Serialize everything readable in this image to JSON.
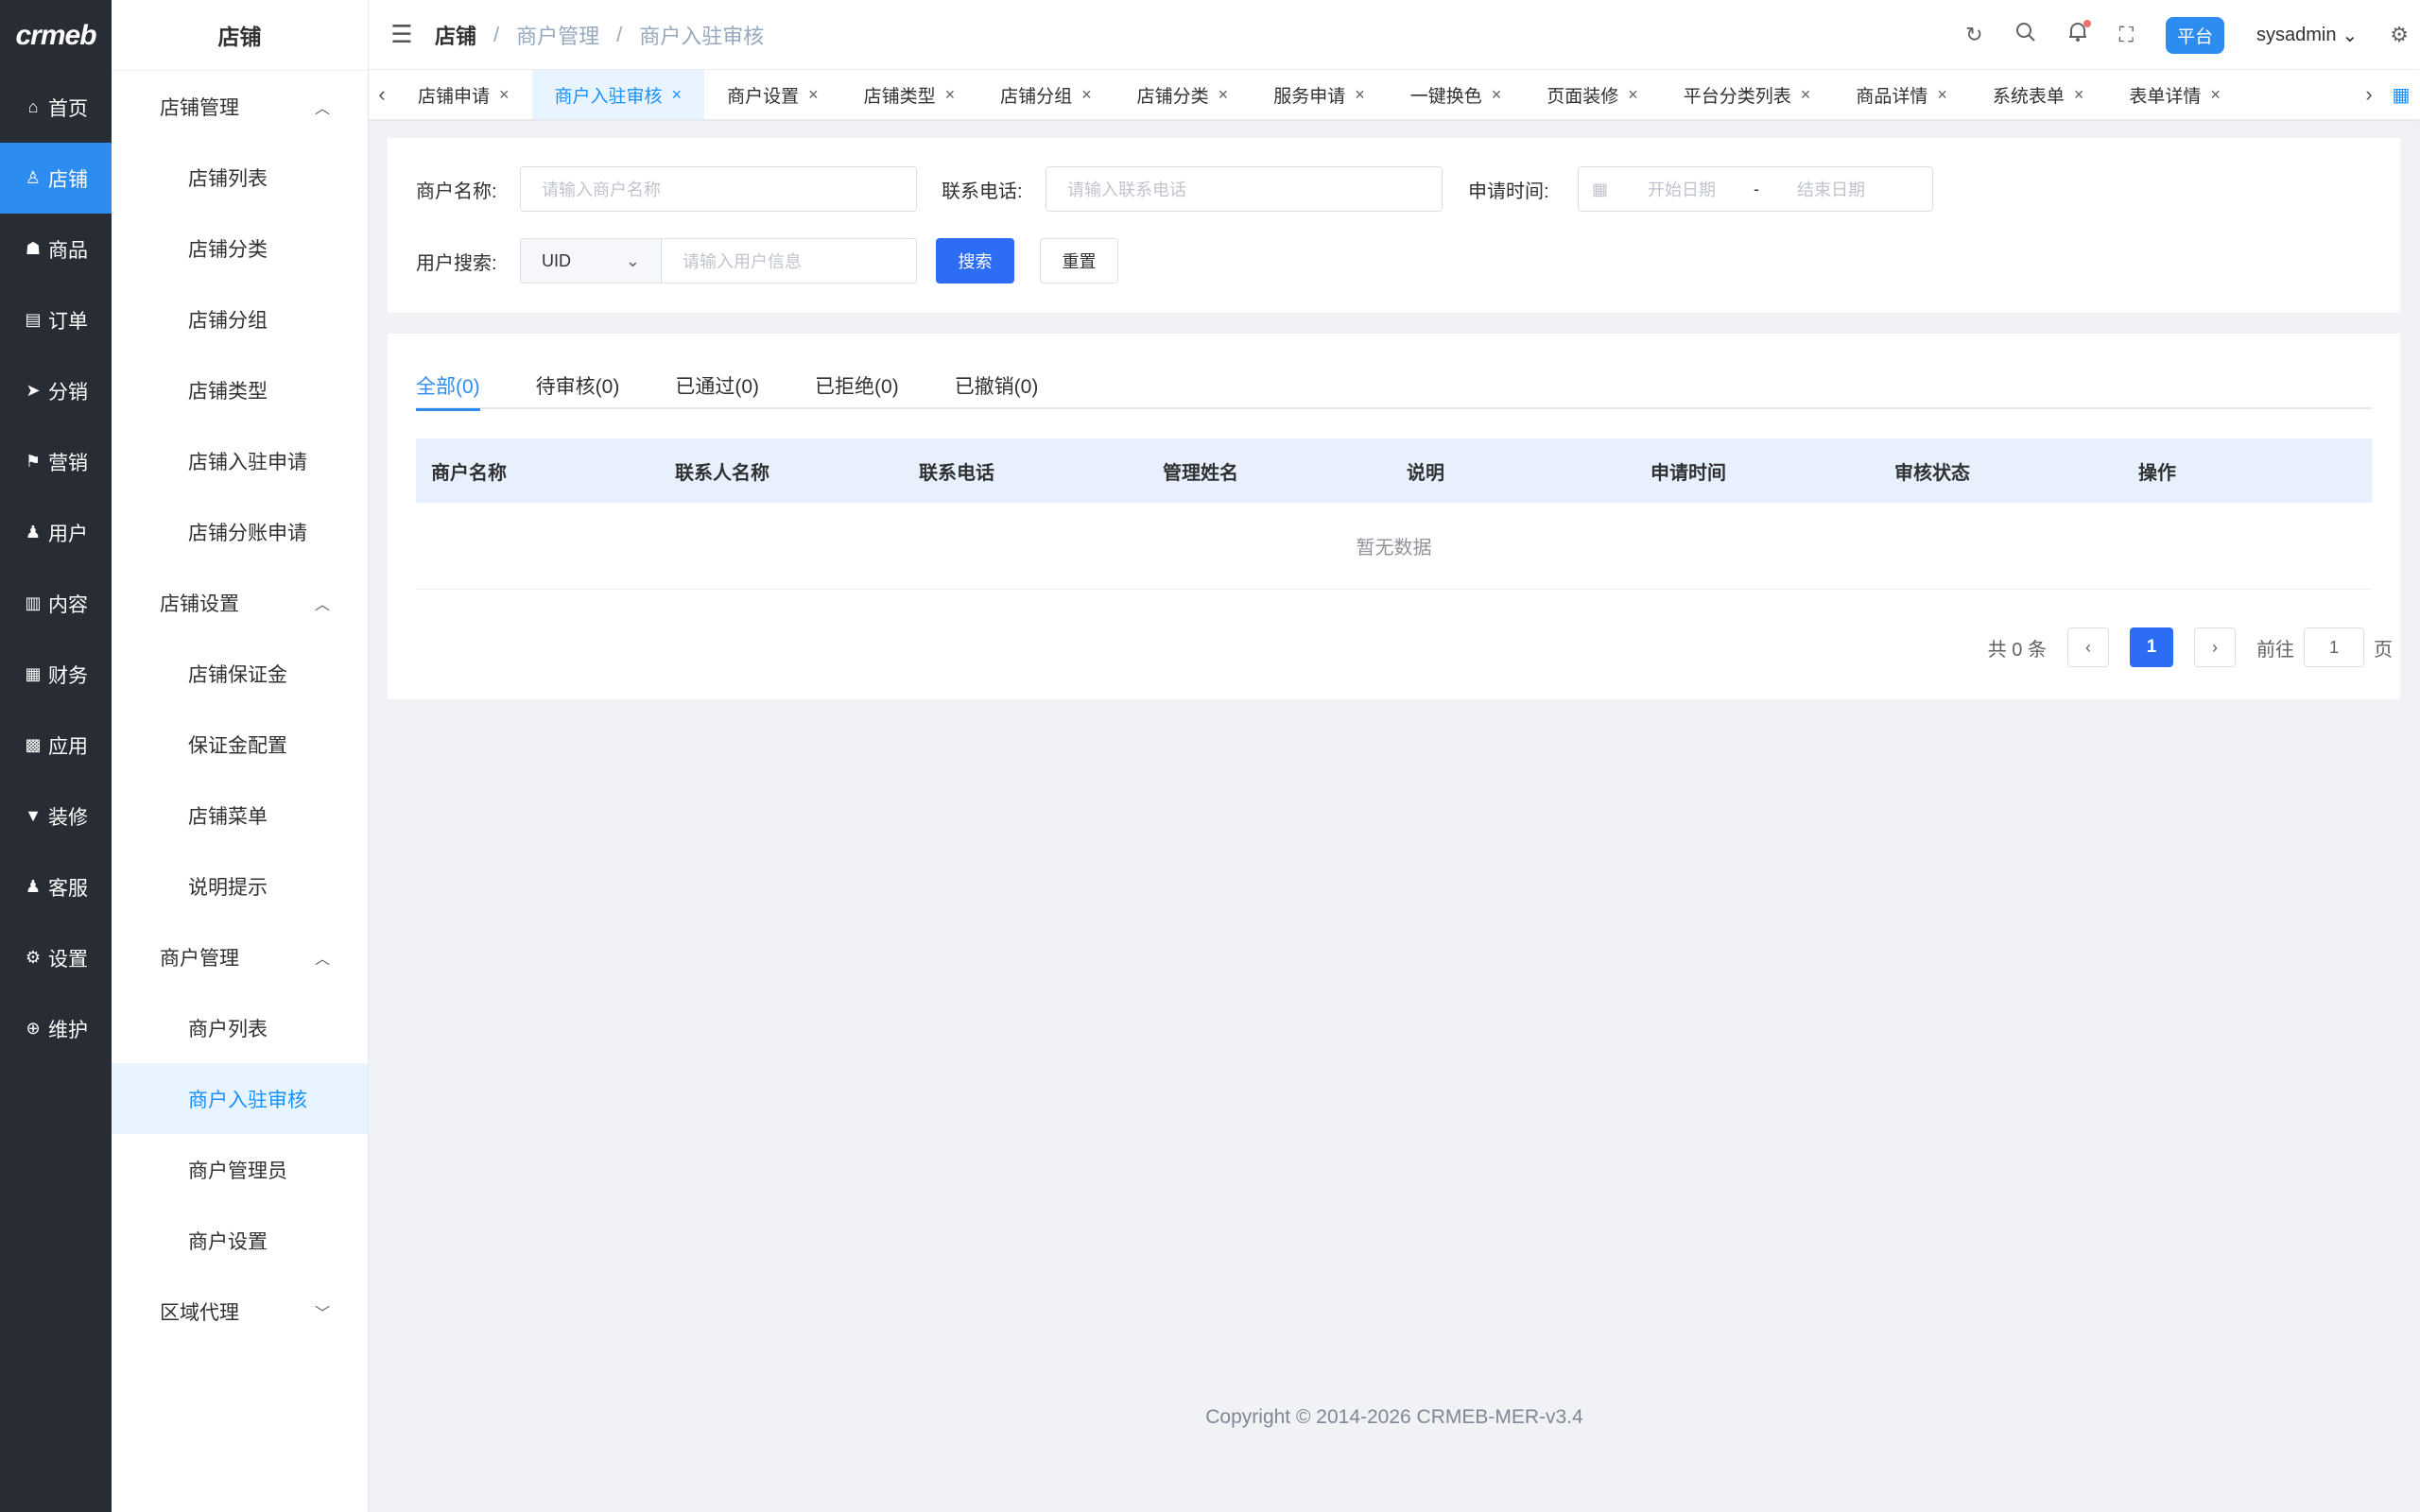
{
  "logo": "crmeb",
  "rail": [
    {
      "icon": "home-icon",
      "glyph": "⌂",
      "label": "首页"
    },
    {
      "icon": "store-icon",
      "glyph": "♙",
      "label": "店铺"
    },
    {
      "icon": "bag-icon",
      "glyph": "☗",
      "label": "商品"
    },
    {
      "icon": "clipboard-icon",
      "glyph": "▤",
      "label": "订单"
    },
    {
      "icon": "send-icon",
      "glyph": "➤",
      "label": "分销"
    },
    {
      "icon": "flag-icon",
      "glyph": "⚑",
      "label": "营销"
    },
    {
      "icon": "user-icon",
      "glyph": "♟",
      "label": "用户"
    },
    {
      "icon": "book-icon",
      "glyph": "▥",
      "label": "内容"
    },
    {
      "icon": "bar-chart-icon",
      "glyph": "▦",
      "label": "财务"
    },
    {
      "icon": "grid-icon",
      "glyph": "▩",
      "label": "应用"
    },
    {
      "icon": "brush-icon",
      "glyph": "▼",
      "label": "装修"
    },
    {
      "icon": "service-icon",
      "glyph": "♟",
      "label": "客服"
    },
    {
      "icon": "gear-icon",
      "glyph": "⚙",
      "label": "设置"
    },
    {
      "icon": "plus-circle-icon",
      "glyph": "⊕",
      "label": "维护"
    }
  ],
  "submenu": {
    "title": "店铺",
    "groups": [
      {
        "label": "店铺管理",
        "items": [
          "店铺列表",
          "店铺分类",
          "店铺分组",
          "店铺类型",
          "店铺入驻申请",
          "店铺分账申请"
        ]
      },
      {
        "label": "店铺设置",
        "items": [
          "店铺保证金",
          "保证金配置",
          "店铺菜单",
          "说明提示"
        ]
      },
      {
        "label": "商户管理",
        "items": [
          "商户列表",
          "商户入驻审核",
          "商户管理员",
          "商户设置"
        ]
      },
      {
        "label": "区域代理",
        "items": []
      }
    ]
  },
  "breadcrumb": [
    "店铺",
    "商户管理",
    "商户入驻审核"
  ],
  "header": {
    "platform": "平台",
    "user": "sysadmin"
  },
  "tabs": [
    "店铺申请",
    "商户入驻审核",
    "商户设置",
    "店铺类型",
    "店铺分组",
    "店铺分类",
    "服务申请",
    "一键换色",
    "页面装修",
    "平台分类列表",
    "商品详情",
    "系统表单",
    "表单详情"
  ],
  "search": {
    "merchant_label": "商户名称:",
    "merchant_placeholder": "请输入商户名称",
    "phone_label": "联系电话:",
    "phone_placeholder": "请输入联系电话",
    "date_label": "申请时间:",
    "date_start": "开始日期",
    "date_sep": "-",
    "date_end": "结束日期",
    "user_label": "用户搜索:",
    "user_type": "UID",
    "user_placeholder": "请输入用户信息",
    "search_btn": "搜索",
    "reset_btn": "重置"
  },
  "status_tabs": [
    "全部(0)",
    "待审核(0)",
    "已通过(0)",
    "已拒绝(0)",
    "已撤销(0)"
  ],
  "table": {
    "columns": [
      "商户名称",
      "联系人名称",
      "联系电话",
      "管理姓名",
      "说明",
      "申请时间",
      "审核状态",
      "操作"
    ],
    "empty": "暂无数据"
  },
  "pager": {
    "total": "共 0 条",
    "page": "1",
    "goto": "前往",
    "goto_value": "1",
    "suffix": "页"
  },
  "footer": "Copyright © 2014-2026 CRMEB-MER-v3.4"
}
